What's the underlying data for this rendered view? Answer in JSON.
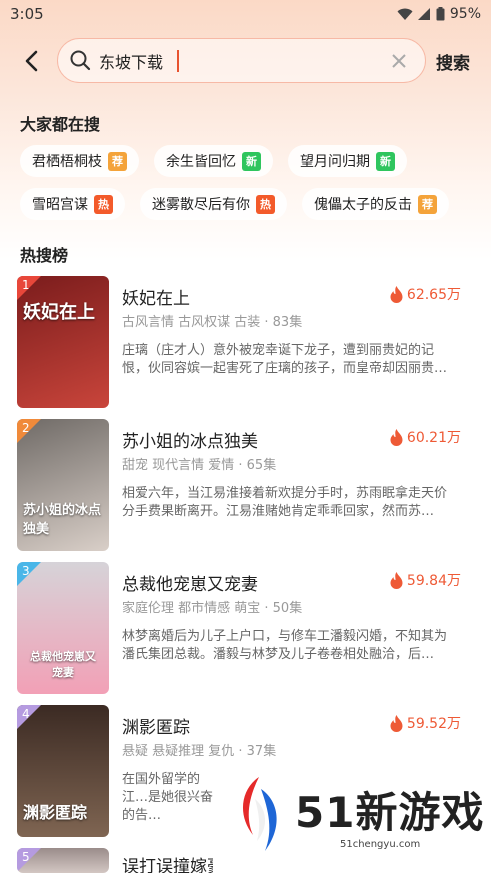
{
  "status": {
    "time": "3:05",
    "battery": "95%"
  },
  "header": {
    "search_value": "东坡下载",
    "search_button": "搜索"
  },
  "popular": {
    "title": "大家都在搜",
    "tags": [
      {
        "label": "君栖梧桐枝",
        "badge": "荐",
        "badge_type": "rec"
      },
      {
        "label": "余生皆回忆",
        "badge": "新",
        "badge_type": "new"
      },
      {
        "label": "望月问归期",
        "badge": "新",
        "badge_type": "new"
      },
      {
        "label": "雪昭宫谋",
        "badge": "热",
        "badge_type": "hot"
      },
      {
        "label": "迷雾散尽后有你",
        "badge": "热",
        "badge_type": "hot"
      },
      {
        "label": "傀儡太子的反击",
        "badge": "荐",
        "badge_type": "rec"
      }
    ]
  },
  "ranking": {
    "title": "热搜榜",
    "items": [
      {
        "rank": "1",
        "title": "妖妃在上",
        "heat": "62.65万",
        "meta": "古风言情 古风权谋 古装 · 83集",
        "desc": "庄璃（庄才人）意外被宠幸诞下龙子，遭到丽贵妃的记恨，伙同容嫔一起害死了庄璃的孩子，而皇帝却因丽贵…",
        "cover_text": "妖妃在上",
        "cover_colors": [
          "#7a1c1c",
          "#c9453b"
        ],
        "num_color": "#e8473a"
      },
      {
        "rank": "2",
        "title": "苏小姐的冰点独美",
        "heat": "60.21万",
        "meta": "甜宠 现代言情 爱情 · 65集",
        "desc": "相爱六年，当江易淮接着新欢提分手时，苏雨眠拿走天价分手费果断离开。江易淮赌她肯定乖乖回家，然而苏…",
        "cover_text": "苏小姐的冰点独美",
        "cover_colors": [
          "#6f6a66",
          "#d9cfc8"
        ],
        "num_color": "#f08a3a"
      },
      {
        "rank": "3",
        "title": "总裁他宠崽又宠妻",
        "heat": "59.84万",
        "meta": "家庭伦理 都市情感 萌宝 · 50集",
        "desc": "林梦离婚后为儿子上户口，与修车工潘毅闪婚，不知其为潘氏集团总裁。潘毅与林梦及儿子卷卷相处融洽，后…",
        "cover_text": "总裁他宠崽又宠妻",
        "cover_colors": [
          "#d6d3d8",
          "#f2a0b6"
        ],
        "num_color": "#4ab6e8"
      },
      {
        "rank": "4",
        "title": "渊影匿踪",
        "heat": "59.52万",
        "meta": "悬疑 悬疑推理 复仇 · 37集",
        "desc": "在国外留学的江…是她很兴奋的告…",
        "cover_text": "渊影匿踪",
        "cover_colors": [
          "#3b2a23",
          "#7f6552"
        ],
        "num_color": "#b59be0"
      },
      {
        "rank": "5",
        "title": "误打误撞嫁豪",
        "heat": "",
        "meta": "",
        "desc": "",
        "cover_text": "",
        "cover_colors": [
          "#9a8c8a",
          "#d3c7c3"
        ],
        "num_color": "#b59be0"
      }
    ]
  },
  "watermark": {
    "brand": "51新游戏",
    "url": "51chengyu.com"
  }
}
